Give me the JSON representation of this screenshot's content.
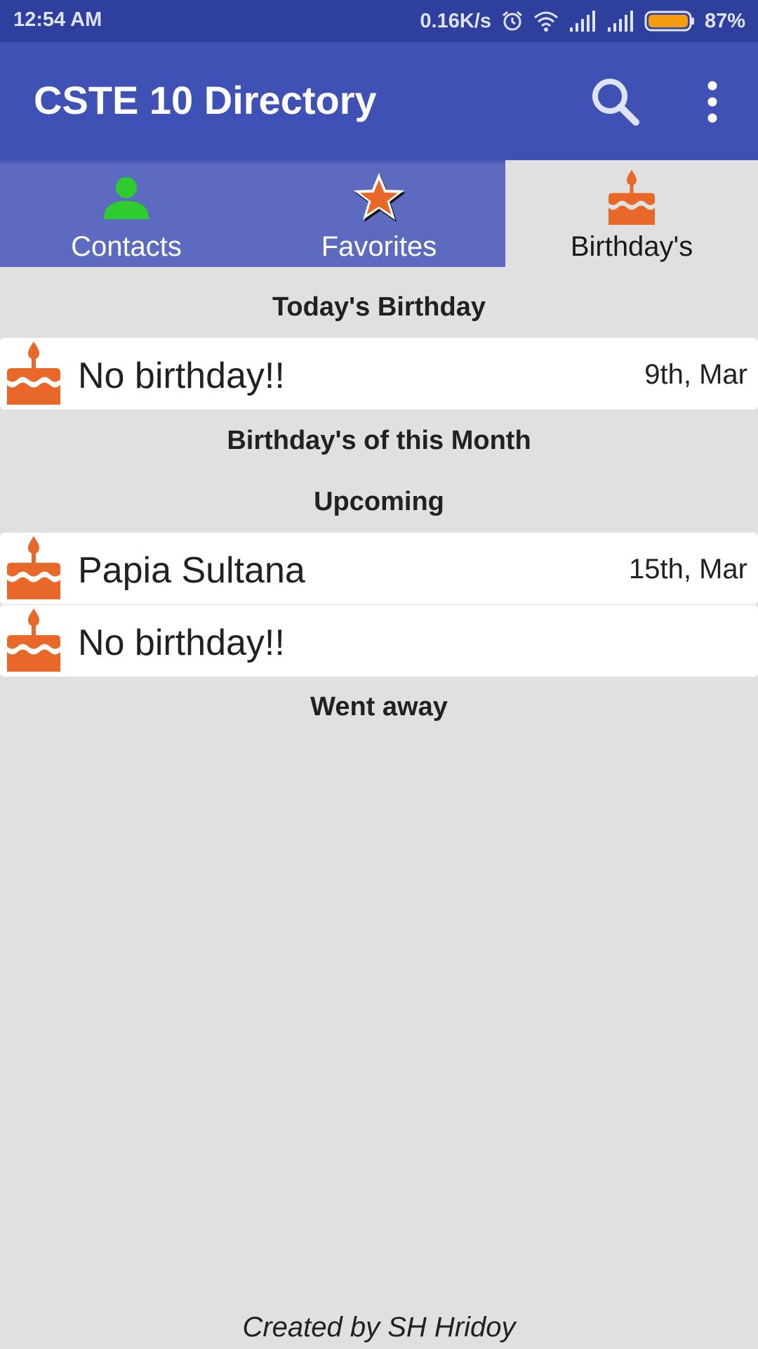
{
  "status_bar": {
    "time": "12:54 AM",
    "net_speed": "0.16K/s",
    "battery": "87%",
    "icons": [
      "alarm-icon",
      "wifi-icon",
      "signal-icon",
      "signal-icon",
      "battery-icon"
    ],
    "battery_color": "#f39c12"
  },
  "app_bar": {
    "title": "CSTE 10 Directory",
    "background": "#3f51b5",
    "actions": [
      "search-icon",
      "more-vert-icon"
    ]
  },
  "tabs": [
    {
      "label": "Contacts",
      "icon": "person-icon",
      "active": false
    },
    {
      "label": "Favorites",
      "icon": "star-icon",
      "active": false
    },
    {
      "label": "Birthday's",
      "icon": "cake-icon",
      "active": true
    }
  ],
  "sections": {
    "today": {
      "title": "Today's Birthday",
      "items": [
        {
          "name": "No birthday!!",
          "date": "9th, Mar"
        }
      ]
    },
    "this_month": {
      "title": "Birthday's of this Month"
    },
    "upcoming": {
      "title": "Upcoming",
      "items": [
        {
          "name": "Papia Sultana",
          "date": "15th, Mar"
        },
        {
          "name": "No birthday!!",
          "date": ""
        }
      ]
    },
    "went_away": {
      "title": "Went away"
    }
  },
  "footer": {
    "text": "Created by SH Hridoy"
  },
  "colors": {
    "accent": "#e8682a",
    "tab_background": "#5c6bc0",
    "page_background": "#e0e0e0",
    "person_icon": "#2ecc2e"
  }
}
